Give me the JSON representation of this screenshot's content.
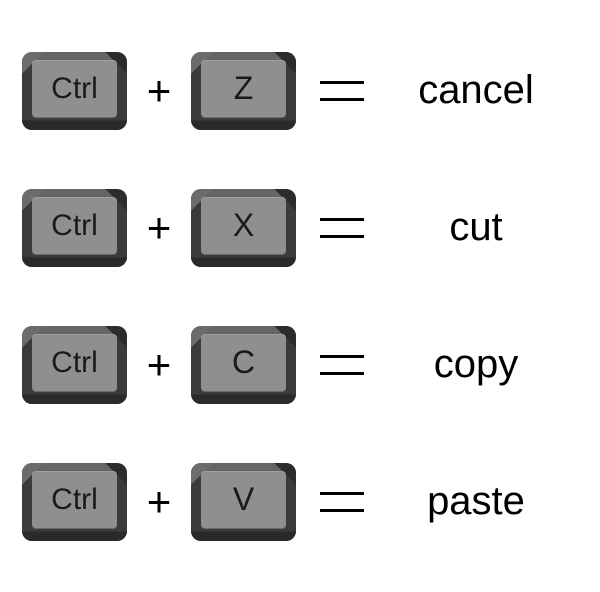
{
  "shortcuts": [
    {
      "mod": "Ctrl",
      "key": "Z",
      "action": "cancel"
    },
    {
      "mod": "Ctrl",
      "key": "X",
      "action": "cut"
    },
    {
      "mod": "Ctrl",
      "key": "C",
      "action": "copy"
    },
    {
      "mod": "Ctrl",
      "key": "V",
      "action": "paste"
    }
  ],
  "symbols": {
    "plus": "+"
  }
}
